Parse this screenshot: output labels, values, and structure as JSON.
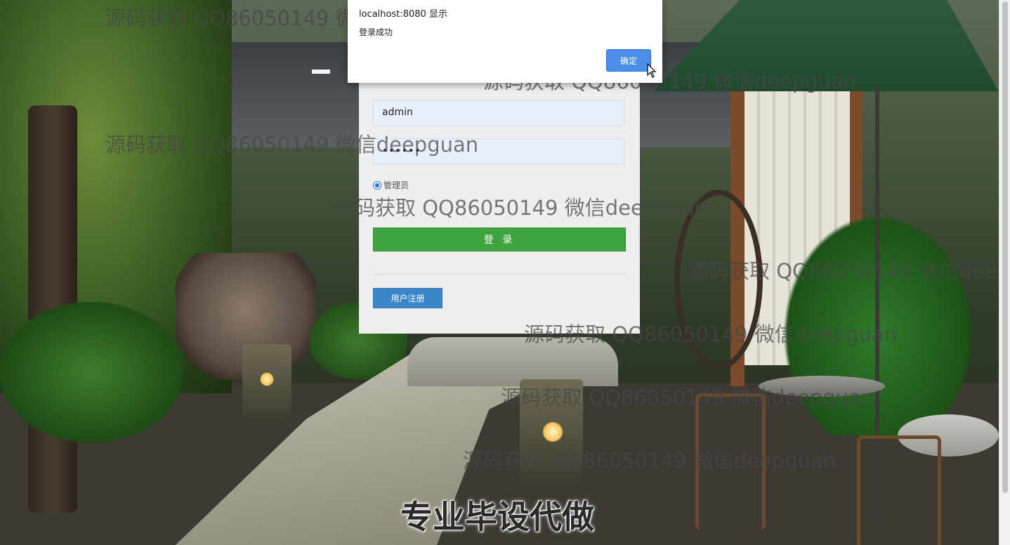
{
  "alert": {
    "origin": "localhost:8080 显示",
    "message": "登录成功",
    "ok_label": "确定"
  },
  "login_form": {
    "username_value": "admin",
    "password_mask": "••••••",
    "role_label": "管理员",
    "login_label": "登 录",
    "register_label": "用户注册"
  },
  "watermark": {
    "text": "源码获取 QQ86050149 微信deepguan"
  },
  "banner_caption": "专业毕设代做",
  "colors": {
    "login_button": "#3fa33f",
    "register_button": "#3a86c8",
    "alert_ok_button": "#4a8ee8",
    "input_fill": "#e8f0fe"
  }
}
